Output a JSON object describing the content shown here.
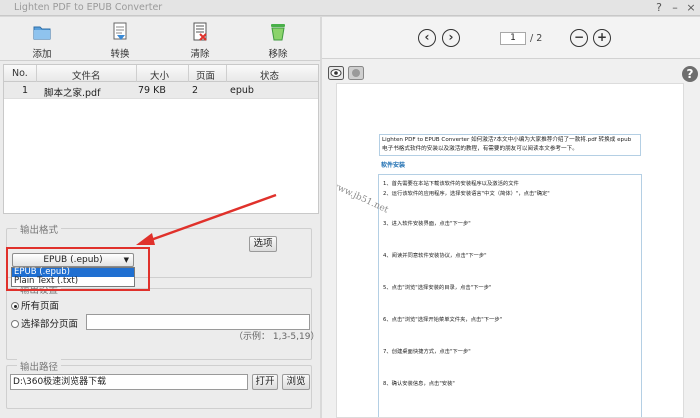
{
  "window": {
    "title": "Lighten PDF to EPUB Converter",
    "help_glyph": "?",
    "min_glyph": "–",
    "close_glyph": "×"
  },
  "toolbar": {
    "add": "添加",
    "convert": "转换",
    "clear": "清除",
    "remove": "移除"
  },
  "file_table": {
    "columns": [
      "No.",
      "文件名",
      "大小",
      "页面",
      "状态"
    ],
    "rows": [
      {
        "no": "1",
        "name": "脚本之家.pdf",
        "size": "79 KB",
        "pages": "2",
        "status": "epub"
      }
    ]
  },
  "output_format": {
    "title": "输出格式",
    "selected": "EPUB (.epub)",
    "options": [
      "EPUB (.epub)",
      "Plain Text (.txt)"
    ],
    "options_button": "选项"
  },
  "output_settings": {
    "title": "输出设置",
    "all_pages": "所有页面",
    "select_pages": "选择部分页面",
    "pages_value": "",
    "example": "（示例：  1,3-5,19）"
  },
  "output_path": {
    "title": "输出路径",
    "value": "D:\\360极速浏览器下载",
    "open_button": "打开",
    "browse_button": "浏览"
  },
  "nav": {
    "current_page": "1",
    "total": "/ 2",
    "prev_glyph": "‹",
    "next_glyph": "›",
    "zoom_out_glyph": "−",
    "zoom_in_glyph": "+"
  },
  "viewer": {
    "help_glyph": "?"
  },
  "document": {
    "intro": "Lighten PDF to EPUB Converter 如何激活?本文中小编为大家推荐介绍了一款将.pdf 转换成 epub 电子书格式软件的安装以及激活的教程，有需要的朋友可以阅读本文参考一下。",
    "install_heading": "软件安装",
    "steps": [
      "1、首先需要在本站下载该软件的安装程序以及激活的文件",
      "2、运行该软件的应用程序，选择安装语言\"中文（简体）\"，点击\"确定\"",
      "3、进入软件安装界面，点击\"下一步\"",
      "4、阅读并同意软件安装协议，点击\"下一步\"",
      "5、点击\"浏览\"选择安装的目录，点击\"下一步\"",
      "6、点击\"浏览\"选择开始菜单文件夹，点击\"下一步\"",
      "7、创建桌面快捷方式，点击\"下一步\"",
      "8、确认安装信息，点击\"安装\""
    ],
    "watermark": "www.jb51.net"
  },
  "colors": {
    "accent_red": "#e0312b",
    "selection_blue": "#1f6fd1",
    "link_blue": "#1f6fb2"
  }
}
